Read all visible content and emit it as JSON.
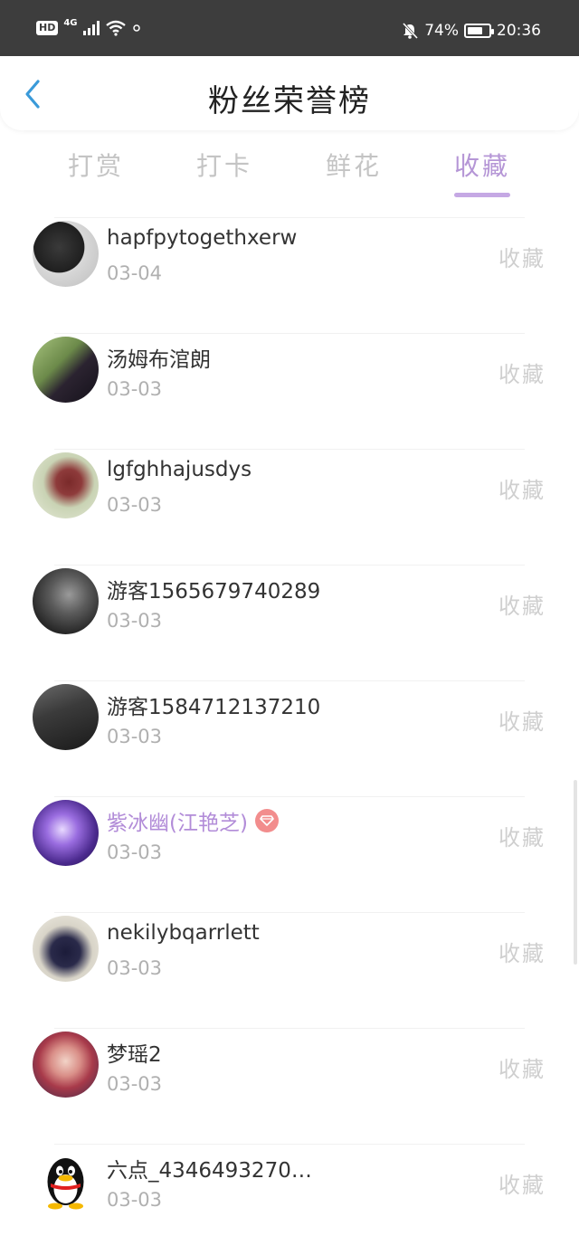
{
  "status_bar": {
    "hd": "HD",
    "network": "4G",
    "battery_percent": "74%",
    "battery_level": 0.74,
    "time": "20:36"
  },
  "header": {
    "title": "粉丝荣誉榜",
    "back_icon": "chevron-left-icon"
  },
  "tabs": [
    {
      "label": "打赏",
      "active": false
    },
    {
      "label": "打卡",
      "active": false
    },
    {
      "label": "鲜花",
      "active": false
    },
    {
      "label": "收藏",
      "active": true
    }
  ],
  "colors": {
    "accent": "#b596d6",
    "status_bar_bg": "#3d3d3d",
    "vip_badge": "#f28d8d",
    "muted_text": "#b0b0b0"
  },
  "items": [
    {
      "name": "hapfpytogethxerw",
      "date": "03-04",
      "action": "收藏",
      "vip": false
    },
    {
      "name": "汤姆布涫朗",
      "date": "03-03",
      "action": "收藏",
      "vip": false
    },
    {
      "name": "lgfghhajusdys",
      "date": "03-03",
      "action": "收藏",
      "vip": false
    },
    {
      "name": "游客1565679740289",
      "date": "03-03",
      "action": "收藏",
      "vip": false
    },
    {
      "name": "游客1584712137210",
      "date": "03-03",
      "action": "收藏",
      "vip": false
    },
    {
      "name": "紫冰幽(江艳芝)",
      "date": "03-03",
      "action": "收藏",
      "vip": true
    },
    {
      "name": "nekilybqarrlett",
      "date": "03-03",
      "action": "收藏",
      "vip": false
    },
    {
      "name": "梦瑶2",
      "date": "03-03",
      "action": "收藏",
      "vip": false
    },
    {
      "name": "六点_4346493270…",
      "date": "03-03",
      "action": "收藏",
      "vip": false
    }
  ]
}
